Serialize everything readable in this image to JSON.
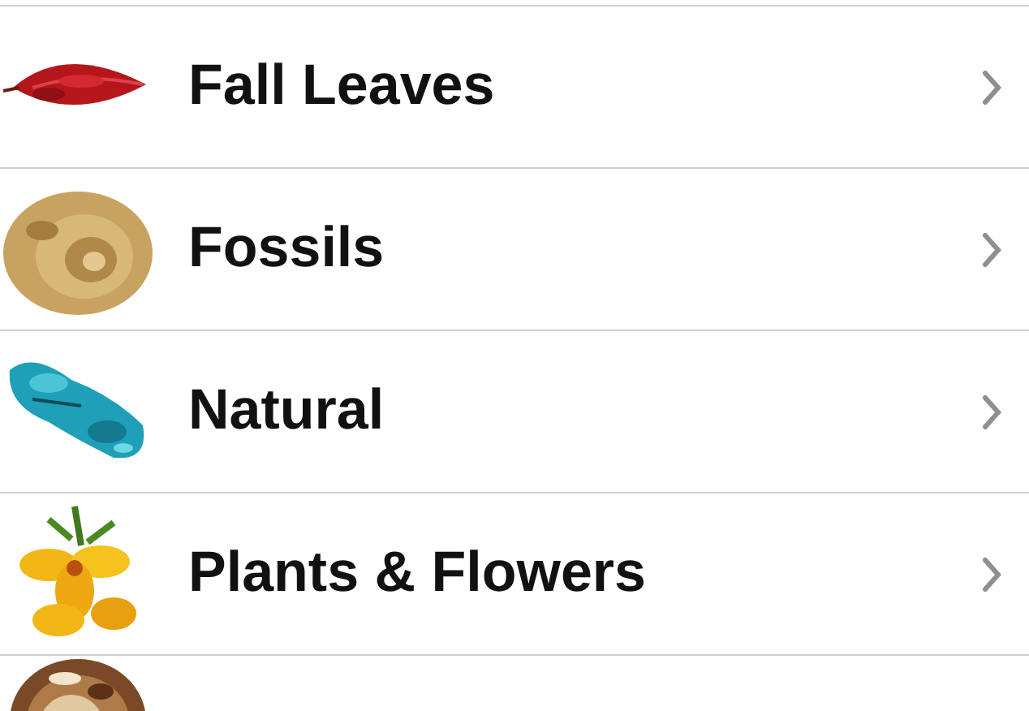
{
  "items": [
    {
      "label": "Fall Leaves"
    },
    {
      "label": "Fossils"
    },
    {
      "label": "Natural"
    },
    {
      "label": "Plants & Flowers"
    }
  ]
}
